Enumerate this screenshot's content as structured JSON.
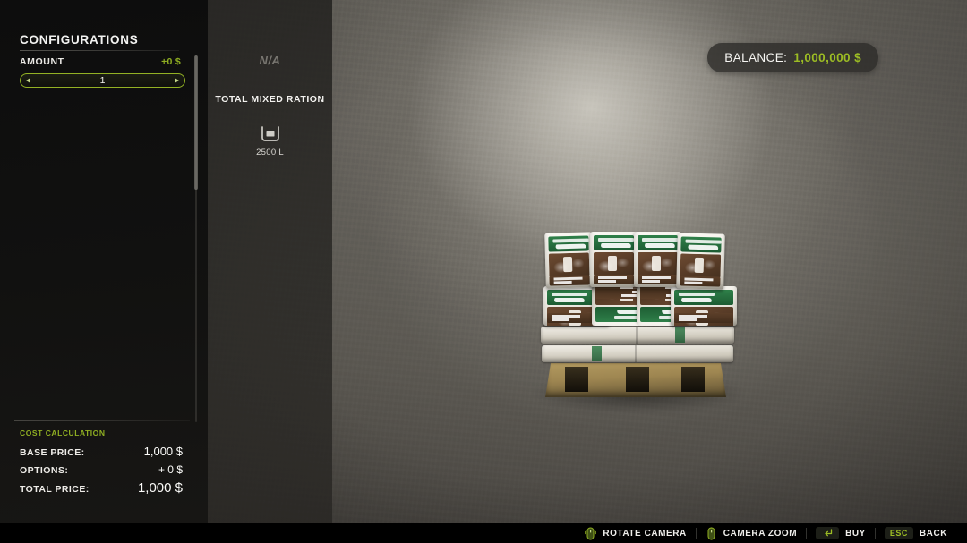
{
  "left_panel": {
    "title": "CONFIGURATIONS",
    "amount_row": {
      "label": "AMOUNT",
      "value": "+0 $"
    },
    "stepper": {
      "value": "1",
      "decrement_icon": "triangle-left-icon",
      "increment_icon": "triangle-right-icon"
    },
    "cost_calculation": {
      "title": "COST CALCULATION",
      "rows": [
        {
          "label": "BASE PRICE:",
          "value": "1,000 $"
        },
        {
          "label": "OPTIONS:",
          "value": "+ 0 $"
        },
        {
          "label": "TOTAL PRICE:",
          "value": "1,000 $"
        }
      ]
    }
  },
  "detail_panel": {
    "brand": "N/A",
    "item_name": "TOTAL MIXED RATION",
    "capacity_icon": "container-capacity-icon",
    "capacity": "2500 L"
  },
  "balance": {
    "label": "BALANCE:",
    "value": "1,000,000 $"
  },
  "bottom_bar": {
    "hints": [
      {
        "icon": "mouse-rotate-icon",
        "label": "ROTATE CAMERA",
        "key": null
      },
      {
        "icon": "mouse-zoom-icon",
        "label": "CAMERA ZOOM",
        "key": null
      },
      {
        "icon": "enter-key-icon",
        "label": "BUY",
        "key": null
      },
      {
        "icon": null,
        "label": "BACK",
        "key": "ESC"
      }
    ]
  },
  "colors": {
    "accent_green": "#9cbc24",
    "panel_dark": "#0c0c0c",
    "text_light": "#f2f2f0"
  },
  "scene": {
    "product": "pallet-of-livestock-feed-bags"
  }
}
